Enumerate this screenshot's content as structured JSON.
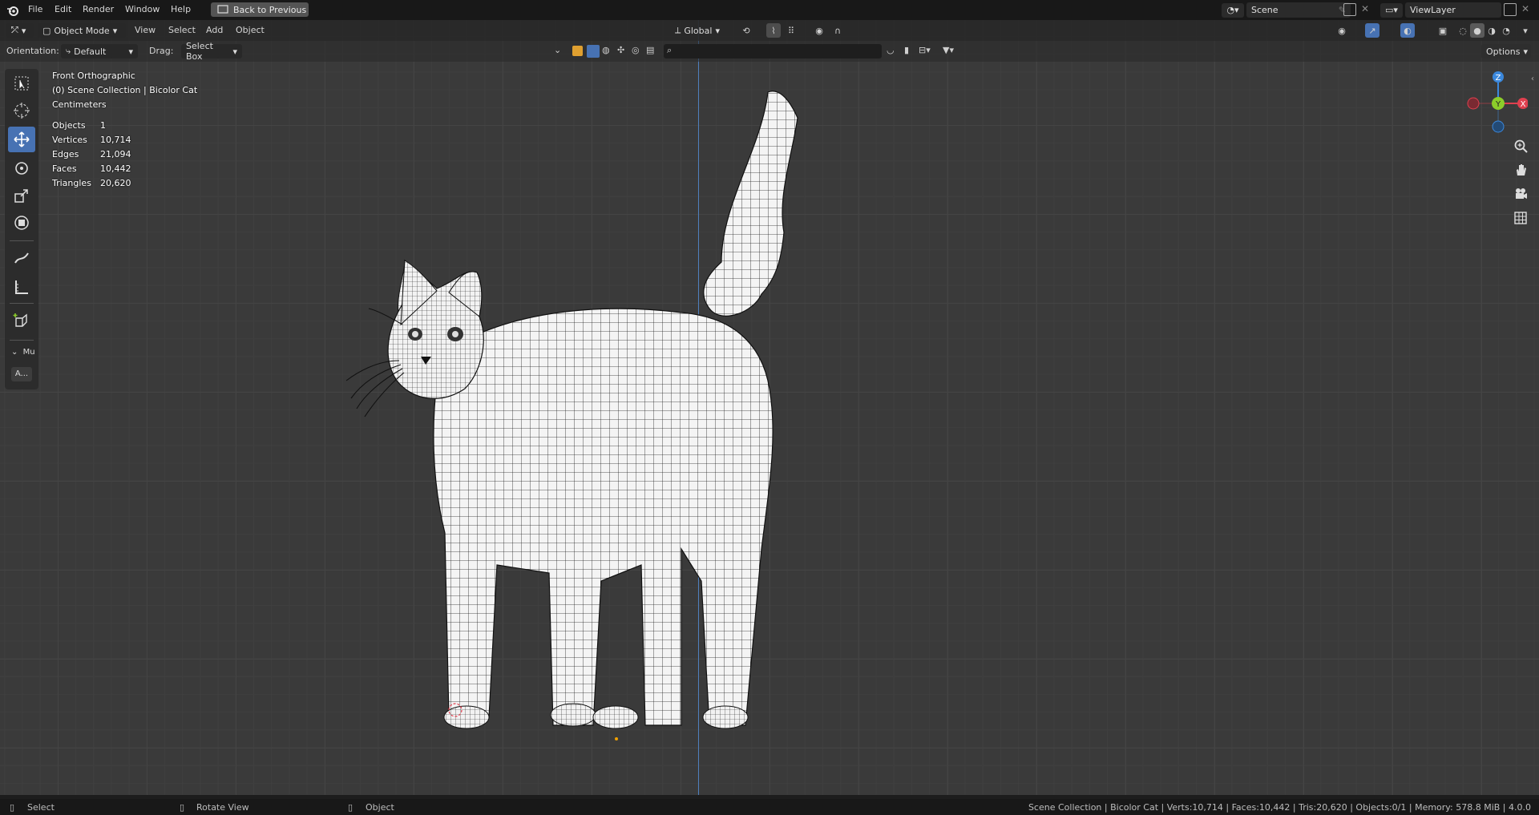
{
  "topbar": {
    "menus": [
      "File",
      "Edit",
      "Render",
      "Window",
      "Help"
    ],
    "back_button": "Back to Previous",
    "scene": "Scene",
    "view_layer": "ViewLayer"
  },
  "header": {
    "mode": "Object Mode",
    "menus": [
      "View",
      "Select",
      "Add",
      "Object"
    ],
    "transform_orientation": "Global",
    "options": "Options"
  },
  "tool_settings": {
    "orientation_label": "Orientation:",
    "orientation_value": "Default",
    "drag_label": "Drag:",
    "drag_value": "Select Box"
  },
  "viewport": {
    "view_name": "Front Orthographic",
    "collection": "(0) Scene Collection | Bicolor Cat",
    "units": "Centimeters",
    "stats": [
      {
        "label": "Objects",
        "value": "1"
      },
      {
        "label": "Vertices",
        "value": "10,714"
      },
      {
        "label": "Edges",
        "value": "21,094"
      },
      {
        "label": "Faces",
        "value": "10,442"
      },
      {
        "label": "Triangles",
        "value": "20,620"
      }
    ],
    "panel_label": "Mu",
    "panel_button": "A..."
  },
  "gizmo": {
    "z": "Z",
    "y": "Y",
    "x": "X"
  },
  "statusbar": {
    "left_select": "Select",
    "rotate": "Rotate View",
    "object": "Object",
    "info": "Scene Collection | Bicolor Cat | Verts:10,714 | Faces:10,442 | Tris:20,620 | Objects:0/1 | Memory: 578.8 MiB | 4.0.0"
  },
  "colors": {
    "accent": "#4772b3",
    "x_axis": "#e0404f",
    "y_axis": "#8ccd2a",
    "z_axis": "#3b88dc"
  }
}
